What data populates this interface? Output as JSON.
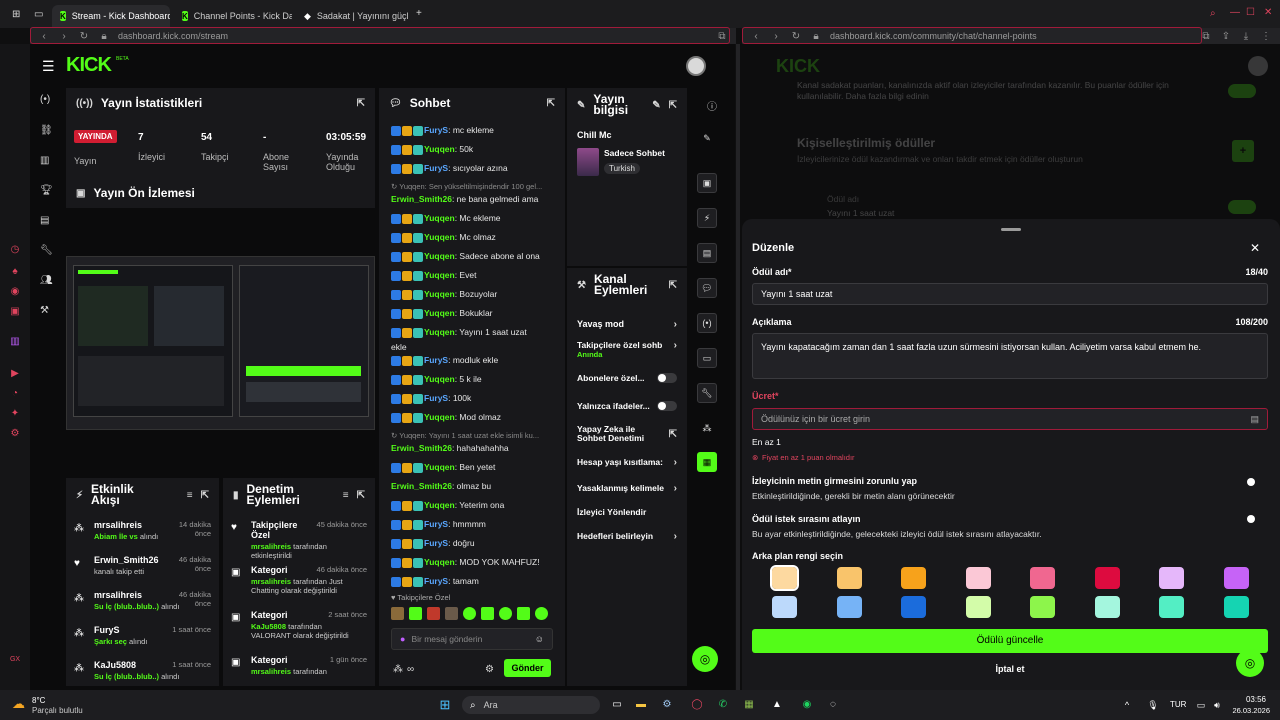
{
  "browser": {
    "tabs": [
      {
        "label": "Stream - Kick Dashboard",
        "active": true
      },
      {
        "label": "Channel Points - Kick Das",
        "active": false
      },
      {
        "label": "Sadakat | Yayınını güçlend",
        "active": false
      }
    ],
    "left_url": "dashboard.kick.com/stream",
    "right_url": "dashboard.kick.com/community/chat/channel-points"
  },
  "dashboard": {
    "logo": "KICK",
    "logo_sup": "BETA",
    "stats": {
      "title": "Yayın İstatistikleri",
      "live_badge": "YAYINDA",
      "items": [
        {
          "value": "",
          "label": "Yayın"
        },
        {
          "value": "7",
          "label": "İzleyici"
        },
        {
          "value": "54",
          "label": "Takipçi"
        },
        {
          "value": "-",
          "label": "Abone Sayısı"
        },
        {
          "value": "03:05:59",
          "label": "Yayında Olduğu"
        }
      ]
    },
    "preview_title": "Yayın Ön İzlemesi",
    "chat": {
      "title": "Sohbet",
      "lines": [
        {
          "user": "FuryS",
          "color": "blue",
          "text": ": mc ekleme"
        },
        {
          "user": "Yuqqen",
          "color": "green",
          "text": ": 50k"
        },
        {
          "user": "FuryS",
          "color": "blue",
          "text": ": sıcıyolar azına"
        },
        {
          "system": "↻ Yuqqen: Sen yükseltilmişindendir 100 gel..."
        },
        {
          "user": "Erwin_Smith26",
          "color": "green",
          "text": ": ne bana gelmedi ama",
          "nobadge": true
        },
        {
          "user": "Yuqqen",
          "color": "green",
          "text": ": Mc ekleme"
        },
        {
          "user": "Yuqqen",
          "color": "green",
          "text": ": Mc olmaz"
        },
        {
          "user": "Yuqqen",
          "color": "green",
          "text": ": Sadece abone al ona"
        },
        {
          "user": "Yuqqen",
          "color": "green",
          "text": ": Evet"
        },
        {
          "user": "Yuqqen",
          "color": "green",
          "text": ": Bozuyolar"
        },
        {
          "user": "Yuqqen",
          "color": "green",
          "text": ": Bokuklar"
        },
        {
          "user": "Yuqqen",
          "color": "green",
          "text": ": Yayını 1 saat uzat"
        },
        {
          "cont": "ekle"
        },
        {
          "user": "FuryS",
          "color": "blue",
          "text": ": modluk ekle"
        },
        {
          "user": "Yuqqen",
          "color": "green",
          "text": ": 5 k ile"
        },
        {
          "user": "FuryS",
          "color": "blue",
          "text": ": 100k"
        },
        {
          "user": "Yuqqen",
          "color": "green",
          "text": ": Mod olmaz"
        },
        {
          "system": "↻ Yuqqen: Yayını 1 saat uzat ekle isimli ku..."
        },
        {
          "user": "Erwin_Smith26",
          "color": "green",
          "text": ": hahahahahha",
          "nobadge": true
        },
        {
          "user": "Yuqqen",
          "color": "green",
          "text": ": Ben yetet"
        },
        {
          "user": "Erwin_Smith26",
          "color": "green",
          "text": ": olmaz bu",
          "nobadge": true
        },
        {
          "user": "Yuqqen",
          "color": "green",
          "text": ": Yeterim ona"
        },
        {
          "user": "FuryS",
          "color": "blue",
          "text": ": hmmmm"
        },
        {
          "user": "FuryS",
          "color": "blue",
          "text": ": doğru"
        },
        {
          "user": "Yuqqen",
          "color": "green",
          "text": ": MOD YOK MAHFUZ!"
        },
        {
          "user": "FuryS",
          "color": "blue",
          "text": ": tamam"
        }
      ],
      "emote_label": "♥ Takipçilere Özel",
      "input_placeholder": "Bir mesaj gönderin",
      "send_label": "Gönder"
    },
    "stream_info": {
      "title": "Yayın bilgisi",
      "stream_title": "Chill Mc",
      "category": "Sadece Sohbet",
      "language": "Turkish"
    },
    "channel_actions": {
      "title": "Kanal Eylemleri",
      "items": [
        {
          "label": "Yavaş mod",
          "kind": "chevron"
        },
        {
          "label": "Takipçilere özel sohb",
          "sub": "Anında",
          "kind": "chevron"
        },
        {
          "label": "Abonelere özel...",
          "kind": "toggle"
        },
        {
          "label": "Yalnızca ifadeler...",
          "kind": "toggle"
        },
        {
          "label": "Yapay Zeka ile Sohbet Denetimi",
          "kind": "external"
        },
        {
          "label": "Hesap yaşı kısıtlama:",
          "kind": "chevron"
        },
        {
          "label": "Yasaklanmış kelimele",
          "kind": "chevron"
        },
        {
          "label": "İzleyici Yönlendir",
          "kind": "none"
        },
        {
          "label": "Hedefleri belirleyin",
          "kind": "chevron"
        }
      ]
    },
    "activity": {
      "title": "Etkinlik Akışı",
      "items": [
        {
          "user": "mrsalihreis",
          "time": "14 dakika önce",
          "detail": "Abiam İle vs",
          "detail2": "alındı"
        },
        {
          "user": "Erwin_Smith26",
          "time": "46 dakika önce",
          "detail": "",
          "detail2": "kanalı takip etti"
        },
        {
          "user": "mrsalihreis",
          "time": "46 dakika önce",
          "detail": "Su İç (blub..blub..)",
          "detail2": "alındı"
        },
        {
          "user": "FuryS",
          "time": "1 saat önce",
          "detail": "Şarkı seç",
          "detail2": "alındı"
        },
        {
          "user": "KaJu5808",
          "time": "1 saat önce",
          "detail": "Su İç (blub..blub..)",
          "detail2": "alındı"
        }
      ]
    },
    "moderation": {
      "title": "Denetim Eylemleri",
      "items": [
        {
          "title": "Takipçilere Özel",
          "time": "45 dakika önce",
          "by": "mrsalihreis",
          "text": "tarafından etkinleştirildi"
        },
        {
          "title": "Kategori",
          "time": "46 dakika önce",
          "by": "mrsalihreis",
          "text": "tarafından Just Chatting olarak değiştirildi"
        },
        {
          "title": "Kategori",
          "time": "2 saat önce",
          "by": "KaJu5808",
          "text": "tarafından VALORANT olarak değiştirildi"
        },
        {
          "title": "Kategori",
          "time": "1 gün önce",
          "by": "mrsalihreis",
          "text": "tarafından"
        }
      ]
    }
  },
  "right": {
    "bg_text_1": "Kanal sadakat puanları, kanalınızda aktif olan izleyiciler tarafından kazanılır. Bu puanlar ödüller için kullanılabilir. Daha fazla bilgi edinin",
    "bg_heading": "Kişiselleştirilmiş ödüller",
    "bg_text_2": "İzleyicilerinize ödül kazandırmak ve onları takdir etmek için ödüller oluşturun",
    "bg_reward_label": "Ödül adı",
    "bg_reward_value": "Yayını 1 saat uzat",
    "modal": {
      "title": "Düzenle",
      "name_label": "Ödül adı*",
      "name_count": "18/40",
      "name_value": "Yayını 1 saat uzat",
      "desc_label": "Açıklama",
      "desc_count": "108/200",
      "desc_value": "Yayını kapatacağım zaman dan 1 saat fazla uzun sürmesini istiyorsan kullan. Aciliyetim varsa kabul etmem he.",
      "price_label": "Ücret*",
      "price_placeholder": "Ödülünüz için bir ücret girin",
      "price_hint": "En az 1",
      "price_error": "Fiyat en az 1 puan olmalıdır",
      "toggle1_title": "İzleyicinin metin girmesini zorunlu yap",
      "toggle1_desc": "Etkinleştirildiğinde, gerekli bir metin alanı görünecektir",
      "toggle2_title": "Ödül istek sırasını atlayın",
      "toggle2_desc": "Bu ayar etkinleştirildiğinde, gelecekteki izleyici ödül istek sırasını atlayacaktır.",
      "color_label": "Arka plan rengi seçin",
      "colors": [
        "#fdd9a0",
        "#f9c46b",
        "#f7a21b",
        "#fbc8d6",
        "#f06790",
        "#dd0b3f",
        "#e5b7fa",
        "#c663f7",
        "#bcd9fb",
        "#76b3f6",
        "#1b6cdc",
        "#d3fca9",
        "#8df54b",
        "#a4f6de",
        "#53eec4",
        "#15d4b2"
      ],
      "update_label": "Ödülü güncelle",
      "cancel_label": "İptal et"
    }
  },
  "taskbar": {
    "weather_temp": "8°C",
    "weather_text": "Parçalı bulutlu",
    "search_label": "Ara",
    "lang": "TUR",
    "time": "03:56",
    "date": "26.03.2026"
  },
  "accent": "#53fc18"
}
